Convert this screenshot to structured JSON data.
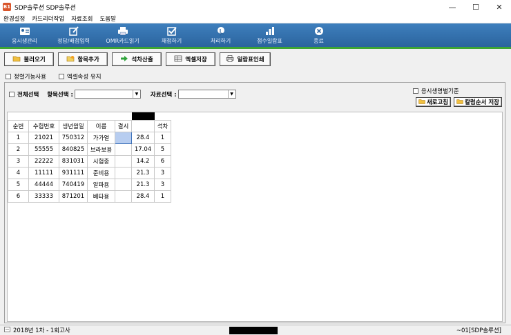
{
  "window": {
    "title": "SDP솔루션 SDP솔루션",
    "icon_text": "B1",
    "min": "—",
    "max": "☐",
    "close": "✕"
  },
  "menu": [
    "환경설정",
    "카드리더작업",
    "자료조회",
    "도움말"
  ],
  "toolbar": [
    {
      "label": "응시생관리",
      "icon": "id-card-icon"
    },
    {
      "label": "정답/배점입력",
      "icon": "edit-icon"
    },
    {
      "label": "OMR카드읽기",
      "icon": "printer-icon"
    },
    {
      "label": "채점하기",
      "icon": "checkbox-icon"
    },
    {
      "label": "처리하기",
      "icon": "cursor-icon"
    },
    {
      "label": "점수일람표",
      "icon": "bar-chart-icon"
    },
    {
      "label": "종료",
      "icon": "close-circle-icon"
    }
  ],
  "actions": [
    {
      "label": "불러오기",
      "icon": "folder-icon"
    },
    {
      "label": "항목추가",
      "icon": "folder-add-icon"
    },
    {
      "label": "석차산출",
      "icon": "arrow-right-icon"
    },
    {
      "label": "엑셀저장",
      "icon": "excel-icon"
    },
    {
      "label": "일람표인쇄",
      "icon": "printer-icon"
    }
  ],
  "options": {
    "filter_feature": "정렬기능사용",
    "excel_keep": "엑셀속성 유지"
  },
  "filters": {
    "select_all": "전체선택",
    "item_select": "항목선택 :",
    "data_select": "자료선택 :"
  },
  "right_panel": {
    "sort_by_birth": "응시생명별기준",
    "refresh": "새로고침",
    "save_col_order": "칼럼순서 저장"
  },
  "table": {
    "headers": [
      "순번",
      "수험번호",
      "생년월일",
      "이름",
      "결시",
      "",
      "석차"
    ],
    "rows": [
      [
        "1",
        "21021",
        "750312",
        "가가열",
        "",
        "28.4",
        "1"
      ],
      [
        "2",
        "55555",
        "840825",
        "브라보용",
        "",
        "17.04",
        "5"
      ],
      [
        "3",
        "22222",
        "831031",
        "시험중",
        "",
        "14.2",
        "6"
      ],
      [
        "4",
        "11111",
        "931111",
        "준비용",
        "",
        "21.3",
        "3"
      ],
      [
        "5",
        "44444",
        "740419",
        "알파용",
        "",
        "21.3",
        "3"
      ],
      [
        "6",
        "33333",
        "871201",
        "베타용",
        "",
        "28.4",
        "1"
      ]
    ]
  },
  "status": {
    "left": "2018년 1차 - 1회고사",
    "right": "~01[SDP솔루션]"
  }
}
